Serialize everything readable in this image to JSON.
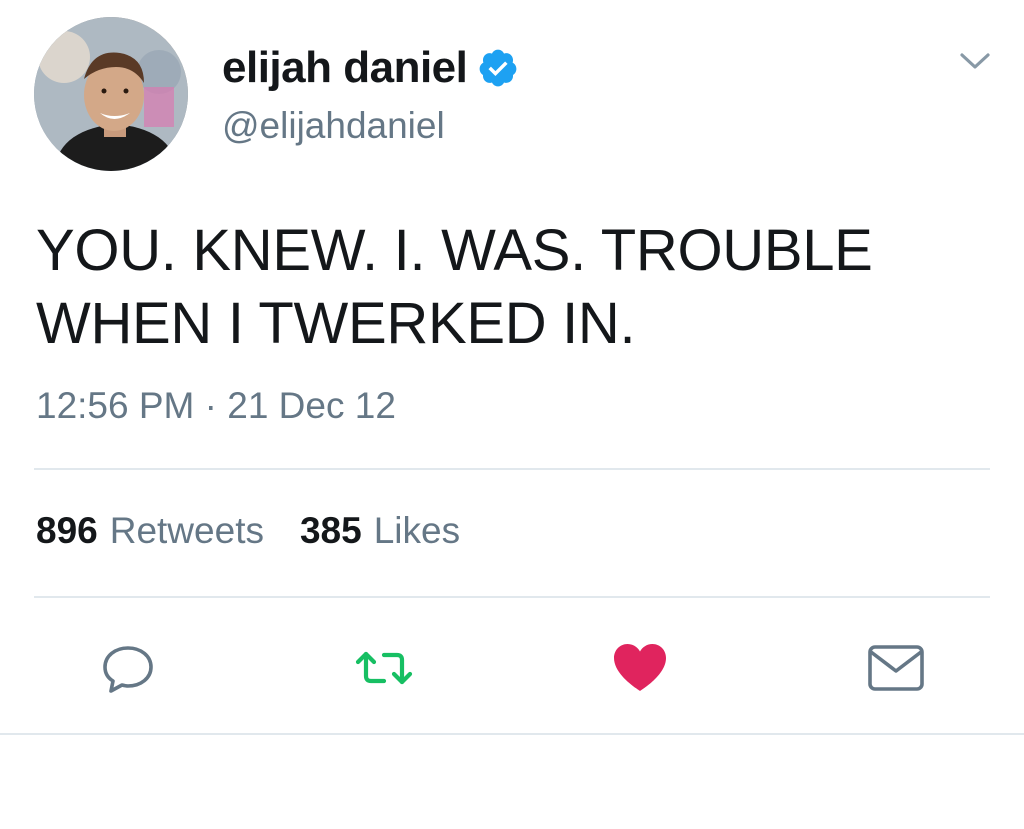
{
  "user": {
    "display_name": "elijah daniel",
    "handle": "@elijahdaniel",
    "verified": true
  },
  "tweet": {
    "text": "YOU. KNEW. I. WAS. TROUBLE WHEN I TWERKED IN.",
    "timestamp": "12:56 PM · 21 Dec 12"
  },
  "stats": {
    "retweets_count": "896",
    "retweets_label": "Retweets",
    "likes_count": "385",
    "likes_label": "Likes"
  },
  "icons": {
    "verified": "verified-badge-icon",
    "menu": "chevron-down-icon",
    "reply": "reply-bubble-icon",
    "retweet": "retweet-icon",
    "like": "heart-icon",
    "dm": "envelope-icon"
  },
  "colors": {
    "text_primary": "#14171a",
    "text_secondary": "#657786",
    "verified_blue": "#1da1f2",
    "retweet_green": "#17bf63",
    "like_red": "#e0245e",
    "icon_gray": "#657786",
    "divider": "#e1e8ed"
  }
}
